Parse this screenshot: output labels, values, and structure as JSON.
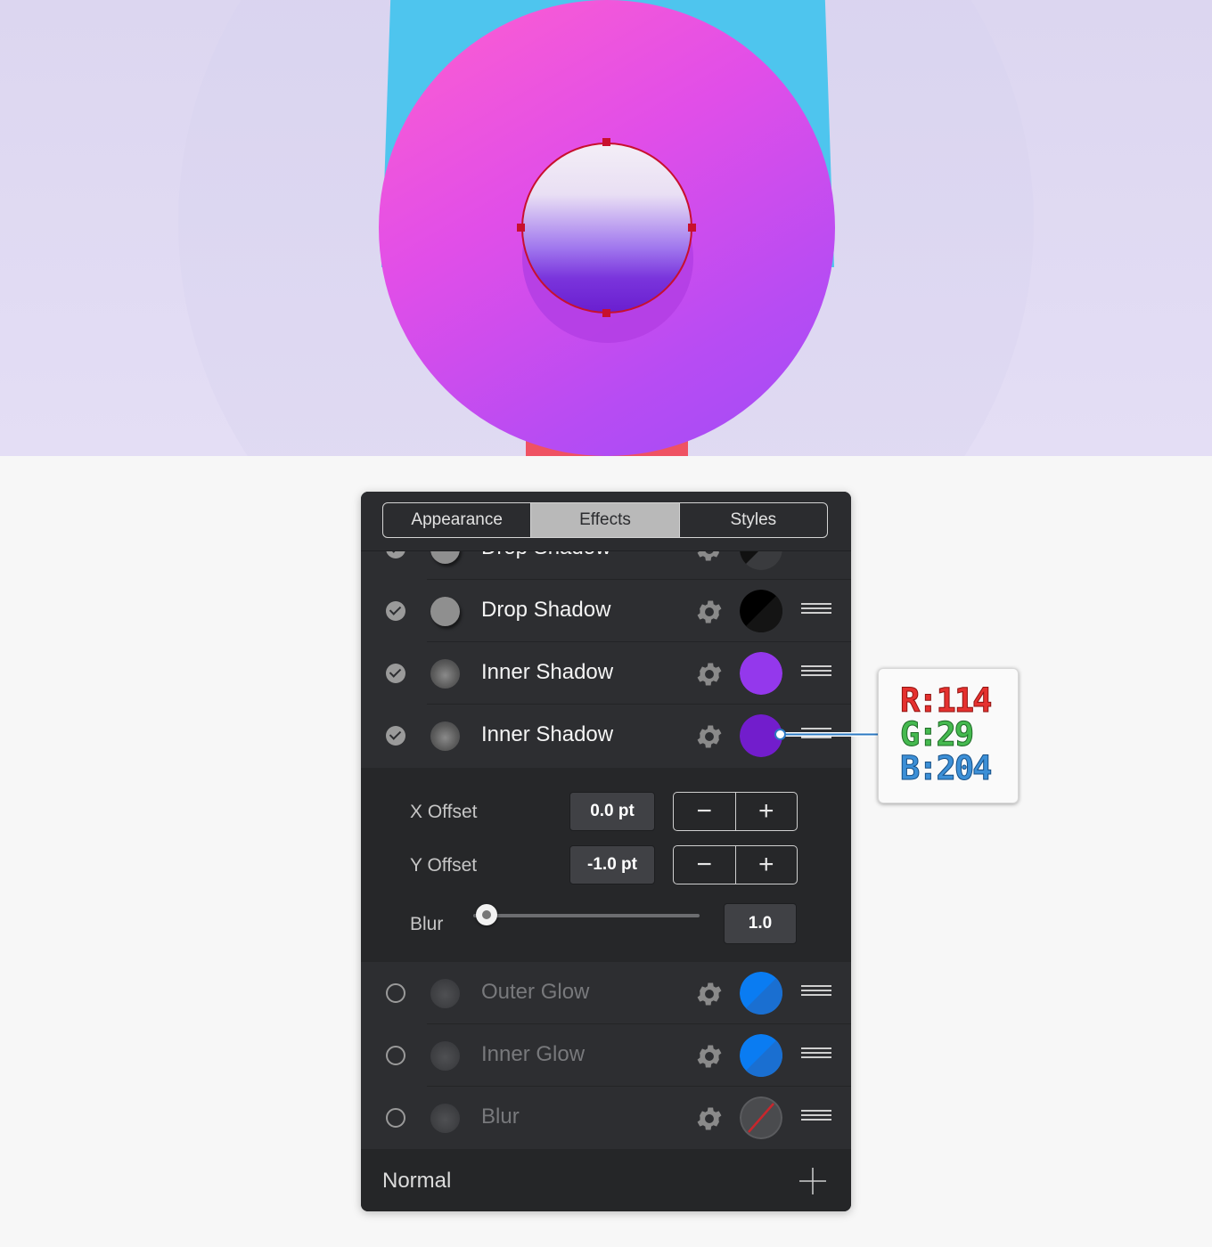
{
  "panel": {
    "tabs": [
      {
        "label": "Appearance",
        "active": false
      },
      {
        "label": "Effects",
        "active": true
      },
      {
        "label": "Styles",
        "active": false
      }
    ],
    "effects": [
      {
        "label": "Drop Shadow",
        "enabled": true,
        "swatch": "#111111"
      },
      {
        "label": "Drop Shadow",
        "enabled": true,
        "swatch": "#000000"
      },
      {
        "label": "Inner Shadow",
        "enabled": true,
        "swatch": "#9438ec"
      },
      {
        "label": "Inner Shadow",
        "enabled": true,
        "swatch": "#721dcc"
      },
      {
        "label": "Outer Glow",
        "enabled": false,
        "swatch": "#0a7cf2"
      },
      {
        "label": "Inner Glow",
        "enabled": false,
        "swatch": "#0a7cf2"
      },
      {
        "label": "Blur",
        "enabled": false,
        "swatch": "none"
      }
    ],
    "settings": {
      "x_offset_label": "X Offset",
      "x_offset_value": "0.0 pt",
      "y_offset_label": "Y Offset",
      "y_offset_value": "-1.0 pt",
      "blur_label": "Blur",
      "blur_value": "1.0"
    },
    "footer": {
      "blend_mode": "Normal"
    }
  },
  "callout": {
    "r": "R:114",
    "g": "G:29",
    "b": "B:204"
  },
  "colors": {
    "disc": "#d14cec",
    "selection": "#c8102e",
    "panel_bg": "#2d2e31"
  }
}
